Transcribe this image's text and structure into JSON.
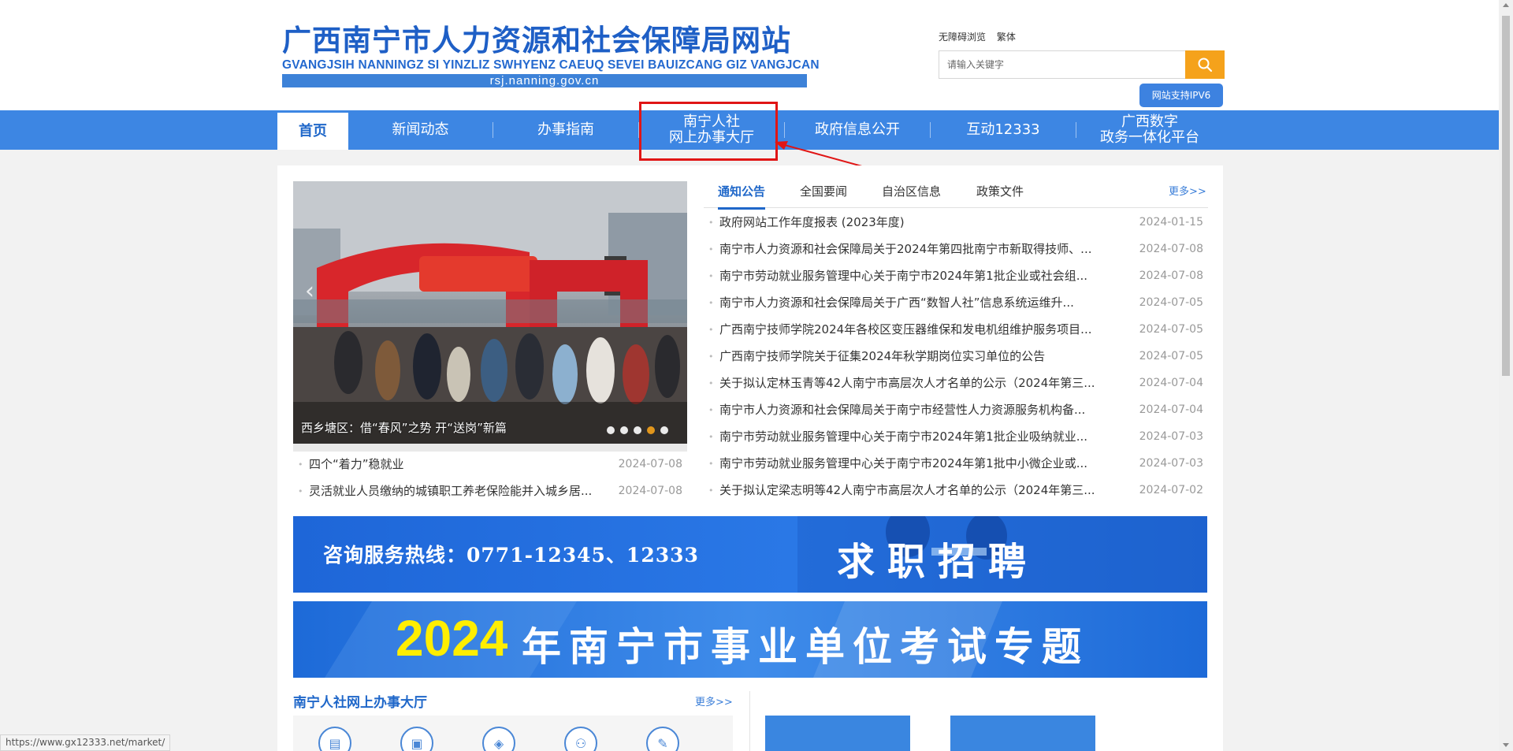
{
  "header": {
    "logo_cn": "广西南宁市人力资源和社会保障局网站",
    "logo_pinyin": "GVANGJSIH NANNINGZ SI YINZLIZ SWHYENZ CAEUQ SEVEI BAUIZCANG GIZ VANGJCAN",
    "logo_url": "rsj.nanning.gov.cn",
    "tools": [
      "无障碍浏览",
      "繁体"
    ],
    "search_placeholder": "请输入关键字",
    "ipv6_badge": "网站支持IPV6"
  },
  "nav": {
    "items": [
      {
        "line1": "首页",
        "line2": ""
      },
      {
        "line1": "新闻动态",
        "line2": ""
      },
      {
        "line1": "办事指南",
        "line2": ""
      },
      {
        "line1": "南宁人社",
        "line2": "网上办事大厅"
      },
      {
        "line1": "政府信息公开",
        "line2": ""
      },
      {
        "line1": "互动12333",
        "line2": ""
      },
      {
        "line1": "广西数字",
        "line2": "政务一体化平台"
      }
    ]
  },
  "slider": {
    "caption": "西乡塘区：借“春风”之势 开“送岗”新篇",
    "dot_count": 5,
    "active_dot": 4
  },
  "left_news": [
    {
      "title": "四个“着力”稳就业",
      "date": "2024-07-08"
    },
    {
      "title": "灵活就业人员缴纳的城镇职工养老保险能并入城乡居...",
      "date": "2024-07-08"
    }
  ],
  "tabs": {
    "items": [
      "通知公告",
      "全国要闻",
      "自治区信息",
      "政策文件"
    ],
    "more": "更多>>"
  },
  "right_news": [
    {
      "title": "政府网站工作年度报表 (2023年度)",
      "date": "2024-01-15"
    },
    {
      "title": "南宁市人力资源和社会保障局关于2024年第四批南宁市新取得技师、...",
      "date": "2024-07-08"
    },
    {
      "title": "南宁市劳动就业服务管理中心关于南宁市2024年第1批企业或社会组...",
      "date": "2024-07-08"
    },
    {
      "title": "南宁市人力资源和社会保障局关于广西“数智人社”信息系统运维升...",
      "date": "2024-07-05"
    },
    {
      "title": "广西南宁技师学院2024年各校区变压器维保和发电机组维护服务项目...",
      "date": "2024-07-05"
    },
    {
      "title": "广西南宁技师学院关于征集2024年秋学期岗位实习单位的公告",
      "date": "2024-07-05"
    },
    {
      "title": "关于拟认定林玉青等42人南宁市高层次人才名单的公示（2024年第三...",
      "date": "2024-07-04"
    },
    {
      "title": "南宁市人力资源和社会保障局关于南宁市经营性人力资源服务机构备...",
      "date": "2024-07-04"
    },
    {
      "title": "南宁市劳动就业服务管理中心关于南宁市2024年第1批企业吸纳就业...",
      "date": "2024-07-03"
    },
    {
      "title": "南宁市劳动就业服务管理中心关于南宁市2024年第1批中小微企业或...",
      "date": "2024-07-03"
    },
    {
      "title": "关于拟认定梁志明等42人南宁市高层次人才名单的公示（2024年第三...",
      "date": "2024-07-02"
    }
  ],
  "banners": {
    "hotline": "咨询服务热线：0771-12345、12333",
    "recruit": "求职招聘",
    "exam_year": "2024",
    "exam_text": "年南宁市事业单位考试专题"
  },
  "service_section": {
    "title": "南宁人社网上办事大厅",
    "more": "更多>>"
  },
  "status_url": "https://www.gx12333.net/market/",
  "colors": {
    "brand_blue": "#3d86e3",
    "search_orange": "#f5a21b",
    "callout_red": "#e01515"
  }
}
